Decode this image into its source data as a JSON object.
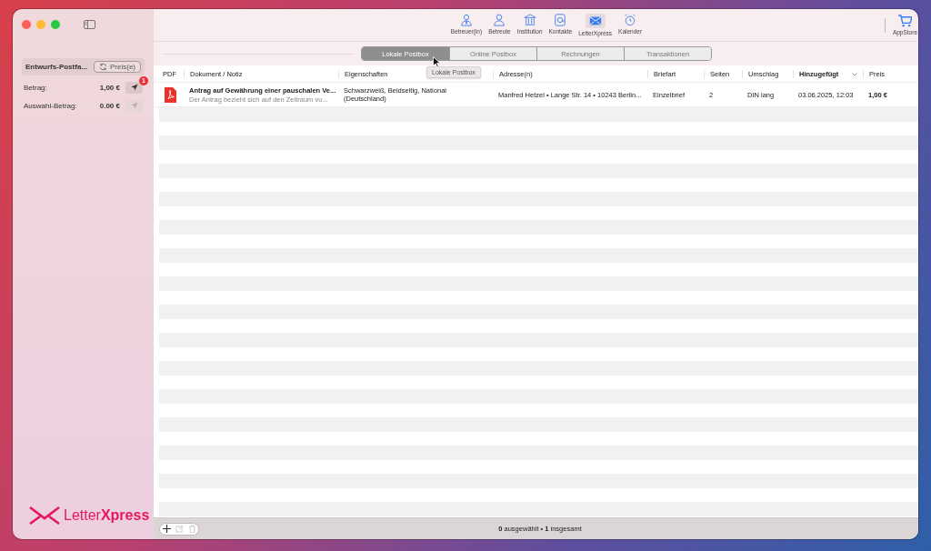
{
  "sidebar": {
    "mailbox_label": "Entwurfs-Postfa...",
    "refresh_button": "Preis(e)",
    "amounts": [
      {
        "label": "Betrag:",
        "value": "1,00 €",
        "badge": "1",
        "disabled": false
      },
      {
        "label": "Auswahl-Betrag:",
        "value": "0.00 €",
        "disabled": true
      }
    ],
    "logo": "Letter**Xpress**"
  },
  "toolbar": {
    "items": [
      {
        "label": "Betreuer(in)",
        "selected": false
      },
      {
        "label": "Betreute",
        "selected": false
      },
      {
        "label": "Institution",
        "selected": false
      },
      {
        "label": "Kontakte",
        "selected": false
      },
      {
        "label": "LetterXpress",
        "selected": true
      },
      {
        "label": "Kalender",
        "selected": false
      }
    ],
    "appstore": "AppStore"
  },
  "tabs": [
    {
      "label": "Lokale Postbox",
      "selected": true
    },
    {
      "label": "Online Postbox",
      "selected": false
    },
    {
      "label": "Rechnungen",
      "selected": false
    },
    {
      "label": "Transaktionen",
      "selected": false
    }
  ],
  "tooltip": "Lokale Postbox",
  "table": {
    "columns": [
      {
        "label": "PDF",
        "sorted": false
      },
      {
        "label": "Dokument / Notiz",
        "sorted": false
      },
      {
        "label": "Eigenschaften",
        "sorted": false
      },
      {
        "label": "Adresse(n)",
        "sorted": false
      },
      {
        "label": "Briefart",
        "sorted": false
      },
      {
        "label": "Seiten",
        "sorted": false
      },
      {
        "label": "Umschlag",
        "sorted": false
      },
      {
        "label": "Hinzugefügt",
        "sorted": true
      },
      {
        "label": "Preis",
        "sorted": false
      }
    ],
    "rows": [
      {
        "document": "Antrag auf Gewährung einer pauschalen Ve...",
        "note": "Der Antrag bezieht sich auf den Zeitraum vo...",
        "properties": "Schwarzweiß, Beidseitig, National (Deutschland)",
        "address": "Manfred Hetzel • Lange Str. 14 • 10243 Berlin...",
        "letter_type": "Einzelbrief",
        "pages": "2",
        "envelope": "DIN lang",
        "added": "03.06.2025, 12:03",
        "price": "1,00 €"
      }
    ]
  },
  "status_bar": {
    "text": "**0** ausgewählt • **1** insgesamt",
    "buttons": [
      {
        "disabled": false
      },
      {
        "disabled": true
      },
      {
        "disabled": true
      }
    ]
  }
}
